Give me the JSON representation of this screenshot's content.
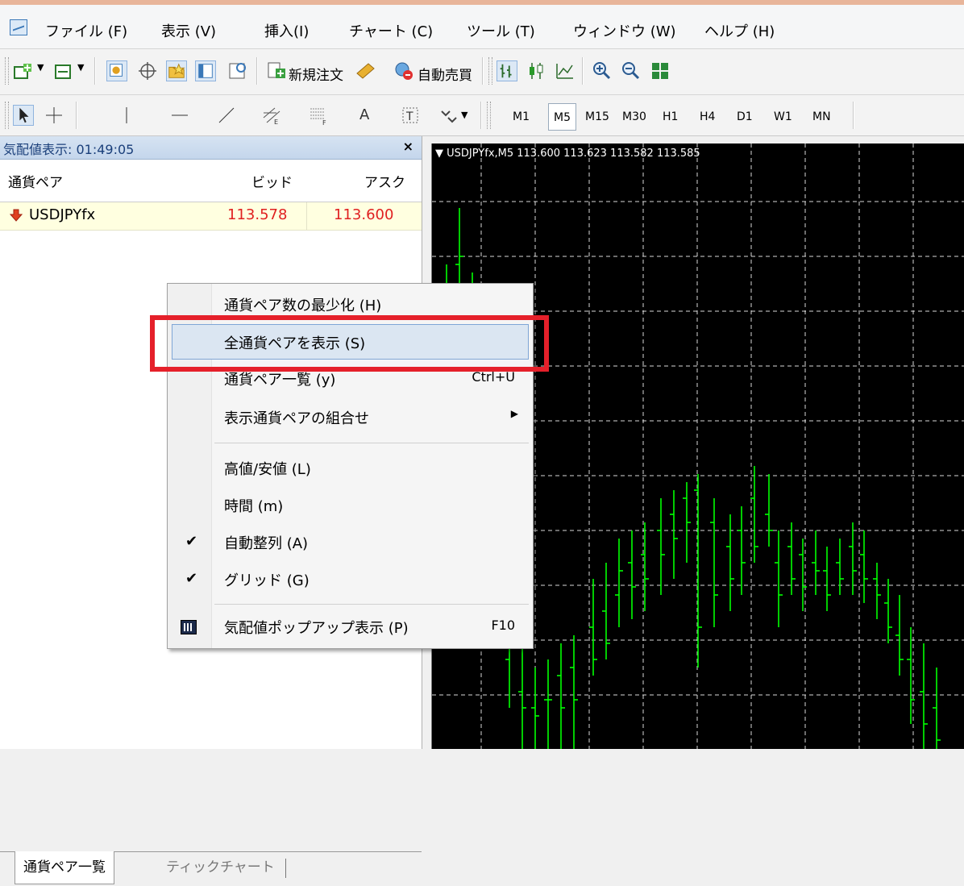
{
  "menubar": {
    "items": [
      "ファイル (F)",
      "表示 (V)",
      "挿入(I)",
      "チャート (C)",
      "ツール (T)",
      "ウィンドウ (W)",
      "ヘルプ (H)"
    ]
  },
  "toolbar": {
    "new_order": "新規注文",
    "auto_trade": "自動売買",
    "timeframes": [
      "M1",
      "M5",
      "M15",
      "M30",
      "H1",
      "H4",
      "D1",
      "W1",
      "MN"
    ],
    "active_timeframe": "M5",
    "text_tool": "A"
  },
  "market_watch": {
    "title": "気配値表示: 01:49:05",
    "close": "×",
    "columns": {
      "symbol": "通貨ペア",
      "bid": "ビッド",
      "ask": "アスク"
    },
    "rows": [
      {
        "symbol": "USDJPYfx",
        "bid": "113.578",
        "ask": "113.600"
      }
    ],
    "tabs": [
      "通貨ペア一覧",
      "ティックチャート"
    ]
  },
  "chart": {
    "header": "USDJPYfx,M5  113.600 113.623 113.582 113.585",
    "bar_color": "#00ff00",
    "grid_color": "#ffffff"
  },
  "context_menu": {
    "items": [
      {
        "label": "通貨ペア数の最少化 (H)"
      },
      {
        "label": "全通貨ペアを表示 (S)",
        "highlighted": true
      },
      {
        "label": "通貨ペア一覧 (y)",
        "shortcut": "Ctrl+U"
      },
      {
        "label": "表示通貨ペアの組合せ",
        "submenu": true
      },
      {
        "label": "高値/安値 (L)"
      },
      {
        "label": "時間 (m)"
      },
      {
        "label": "自動整列 (A)",
        "checked": true
      },
      {
        "label": "グリッド (G)",
        "checked": true
      },
      {
        "label": "気配値ポップアップ表示 (P)",
        "shortcut": "F10",
        "icon": "popup-icon"
      }
    ],
    "check_mark": "✔",
    "submenu_arrow": "▶"
  },
  "annotation": {
    "highlight_color": "#e5202a"
  }
}
